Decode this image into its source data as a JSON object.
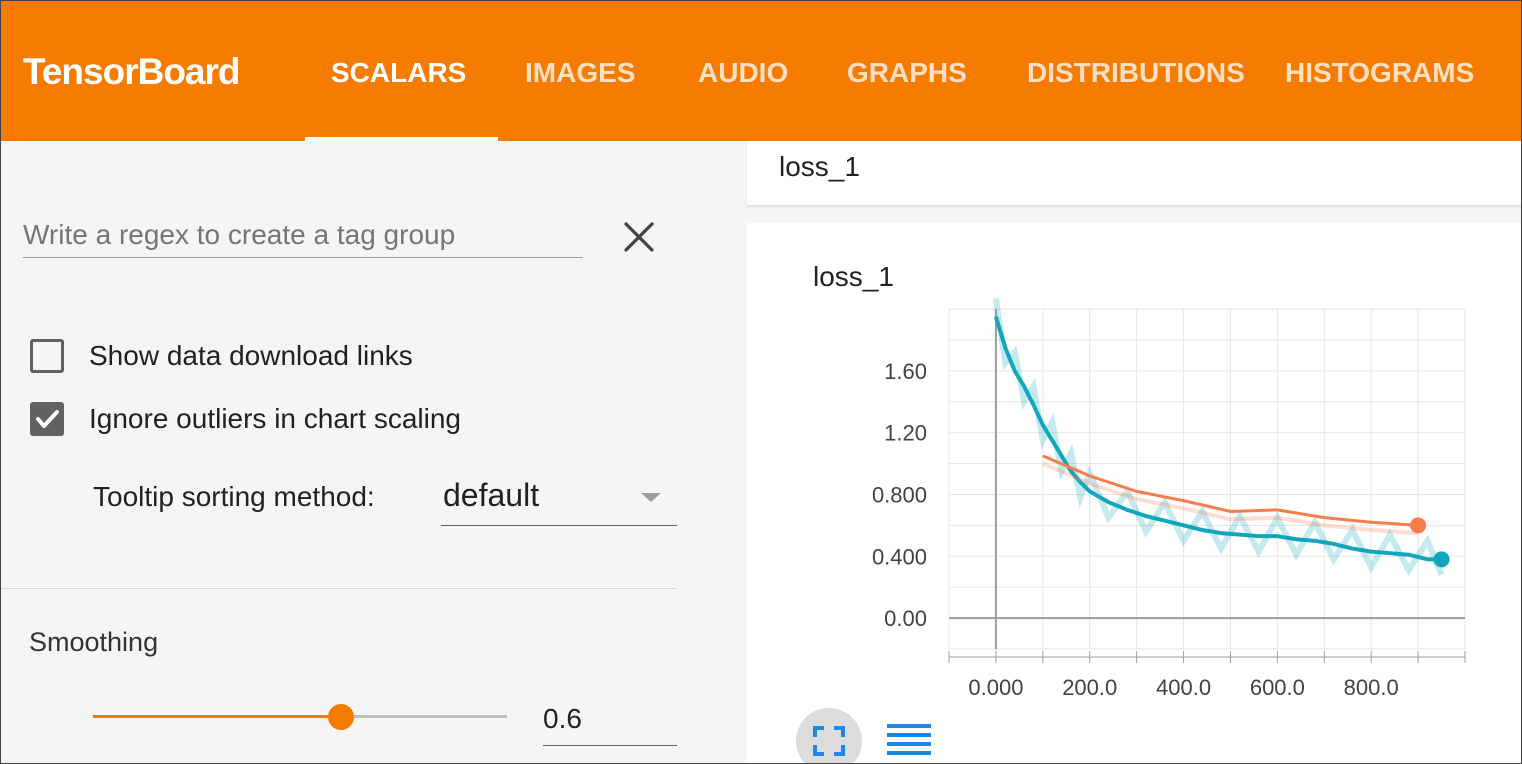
{
  "app": {
    "title": "TensorBoard"
  },
  "tabs": [
    {
      "label": "SCALARS",
      "active": true
    },
    {
      "label": "IMAGES",
      "active": false
    },
    {
      "label": "AUDIO",
      "active": false
    },
    {
      "label": "GRAPHS",
      "active": false
    },
    {
      "label": "DISTRIBUTIONS",
      "active": false
    },
    {
      "label": "HISTOGRAMS",
      "active": false
    }
  ],
  "sidebar": {
    "regex_placeholder": "Write a regex to create a tag group",
    "regex_value": "",
    "checkboxes": [
      {
        "label": "Show data download links",
        "checked": false
      },
      {
        "label": "Ignore outliers in chart scaling",
        "checked": true
      }
    ],
    "tooltip_sorting": {
      "label": "Tooltip sorting method:",
      "value": "default"
    },
    "smoothing": {
      "label": "Smoothing",
      "value": "0.6",
      "level": 0.6
    }
  },
  "main": {
    "group_title": "loss_1",
    "card_title": "loss_1"
  },
  "icons": {
    "clear": "close-icon",
    "fit": "fit-domain-icon",
    "list": "list-icon",
    "dropdown": "dropdown-arrow-icon"
  },
  "colors": {
    "accent": "#f57c00",
    "series_teal": "#12a6bd",
    "series_orange": "#f97c4b"
  },
  "chart_data": {
    "type": "line",
    "title": "",
    "x_ticks": [
      "0.000",
      "200.0",
      "400.0",
      "600.0",
      "800.0"
    ],
    "y_ticks": [
      "0.00",
      "0.400",
      "0.800",
      "1.20",
      "1.60"
    ],
    "xlim": [
      -100,
      1000
    ],
    "ylim": [
      -0.2,
      2.0
    ],
    "grid": true,
    "series": [
      {
        "color": "#12a6bd",
        "x": [
          0,
          20,
          40,
          60,
          80,
          100,
          120,
          140,
          160,
          180,
          200,
          240,
          280,
          320,
          360,
          400,
          440,
          480,
          520,
          560,
          600,
          640,
          680,
          720,
          760,
          800,
          840,
          880,
          920,
          950
        ],
        "y": [
          1.95,
          1.75,
          1.6,
          1.5,
          1.38,
          1.25,
          1.15,
          1.05,
          0.95,
          0.88,
          0.82,
          0.75,
          0.7,
          0.66,
          0.63,
          0.6,
          0.57,
          0.55,
          0.54,
          0.53,
          0.53,
          0.51,
          0.5,
          0.48,
          0.45,
          0.43,
          0.42,
          0.41,
          0.38,
          0.38
        ]
      },
      {
        "color": "#f97c4b",
        "x": [
          100,
          200,
          300,
          400,
          500,
          600,
          700,
          800,
          900
        ],
        "y": [
          1.05,
          0.92,
          0.82,
          0.76,
          0.69,
          0.7,
          0.65,
          0.62,
          0.6
        ]
      }
    ]
  }
}
